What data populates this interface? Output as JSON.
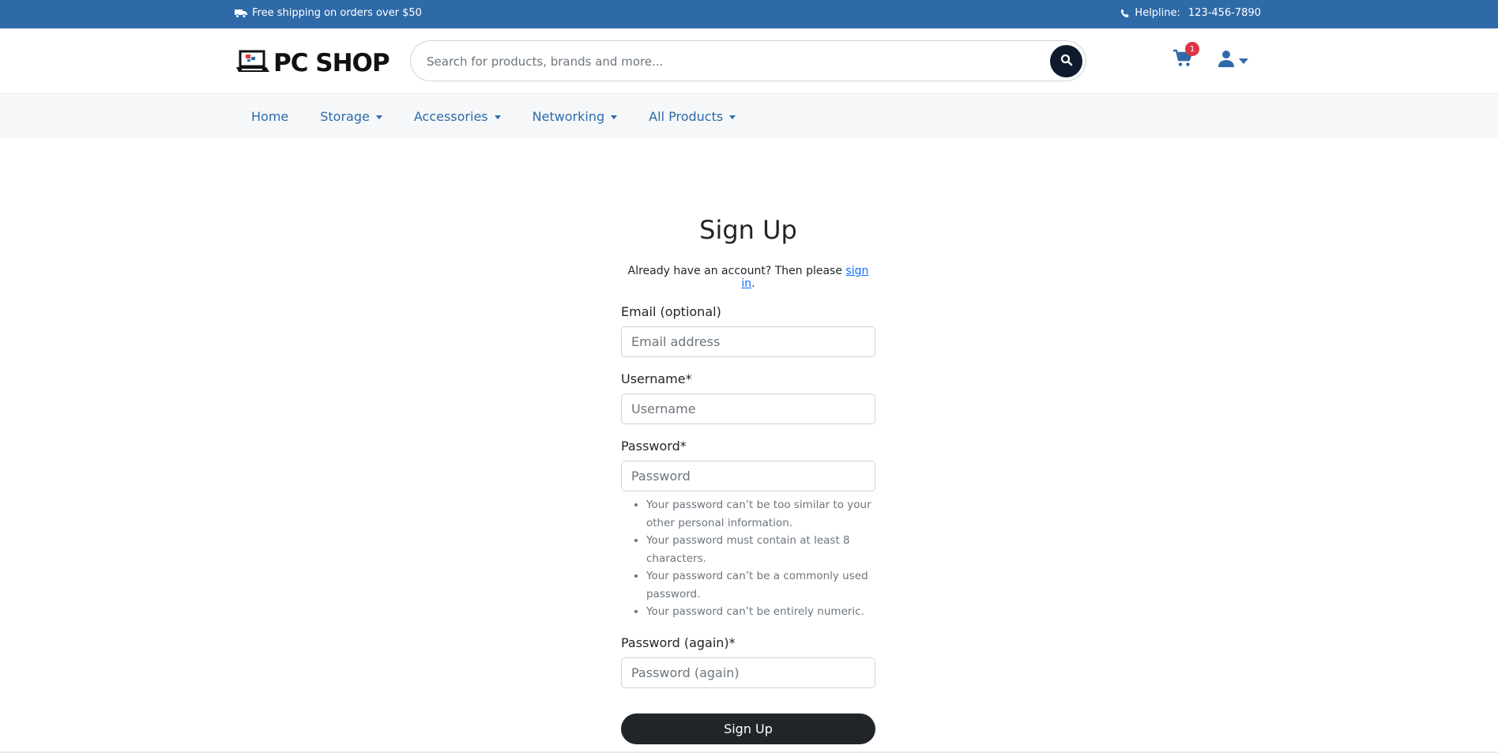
{
  "topbar": {
    "shipping_text": "Free shipping on orders over $50",
    "helpline_label": "Helpline:",
    "helpline_number": "123-456-7890",
    "bg_color": "#2f6aa8"
  },
  "header": {
    "logo_text": "PC SHOP",
    "search_placeholder": "Search for products, brands and more...",
    "cart_count": "1"
  },
  "nav": {
    "items": [
      {
        "label": "Home",
        "dropdown": false
      },
      {
        "label": "Storage",
        "dropdown": true
      },
      {
        "label": "Accessories",
        "dropdown": true
      },
      {
        "label": "Networking",
        "dropdown": true
      },
      {
        "label": "All Products",
        "dropdown": true
      }
    ]
  },
  "form": {
    "title": "Sign Up",
    "signin_prefix": "Already have an account? Then please ",
    "signin_link": "sign in",
    "signin_suffix": ".",
    "email_label": "Email (optional)",
    "email_placeholder": "Email address",
    "username_label": "Username*",
    "username_placeholder": "Username",
    "password_label": "Password*",
    "password_placeholder": "Password",
    "password_help": [
      "Your password can’t be too similar to your other personal information.",
      "Your password must contain at least 8 characters.",
      "Your password can’t be a commonly used password.",
      "Your password can’t be entirely numeric."
    ],
    "password2_label": "Password (again)*",
    "password2_placeholder": "Password (again)",
    "submit_label": "Sign Up"
  }
}
